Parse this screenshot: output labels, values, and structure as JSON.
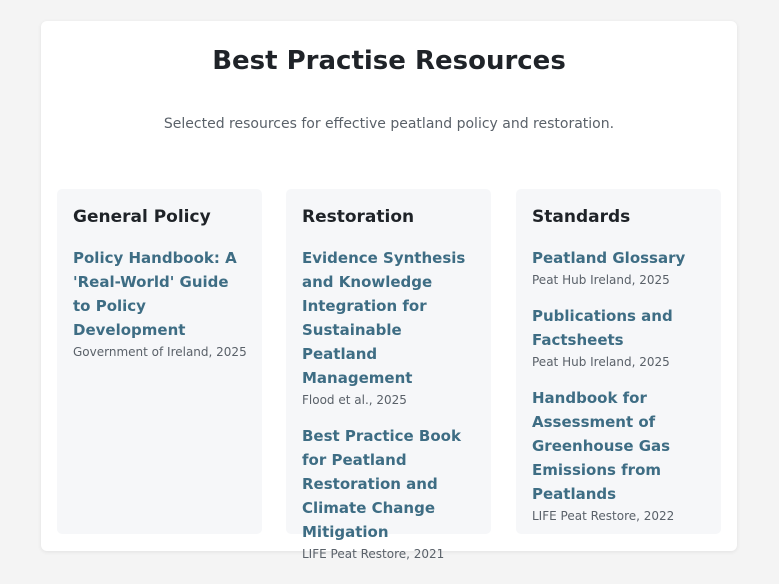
{
  "page": {
    "title": "Best Practise Resources",
    "subtitle": "Selected resources for effective peatland policy and restoration."
  },
  "columns": [
    {
      "title": "General Policy",
      "resources": [
        {
          "title": "Policy Handbook: A 'Real-World' Guide to Policy Development",
          "meta": "Government of Ireland, 2025"
        }
      ]
    },
    {
      "title": "Restoration",
      "resources": [
        {
          "title": "Evidence Synthesis and Knowledge Integration for Sustainable Peatland Management",
          "meta": "Flood et al., 2025"
        },
        {
          "title": "Best Practice Book for Peatland Restoration and Climate Change Mitigation",
          "meta": "LIFE Peat Restore, 2021"
        }
      ]
    },
    {
      "title": "Standards",
      "resources": [
        {
          "title": "Peatland Glossary",
          "meta": "Peat Hub Ireland, 2025"
        },
        {
          "title": "Publications and Factsheets",
          "meta": "Peat Hub Ireland, 2025"
        },
        {
          "title": "Handbook for Assessment of Greenhouse Gas Emissions from Peatlands",
          "meta": "LIFE Peat Restore, 2022"
        }
      ]
    }
  ],
  "colors": {
    "link": "#3e6d84",
    "heading": "#1f2328",
    "muted": "#5a6169",
    "column_bg": "#f6f7f9",
    "page_bg": "#f4f4f4"
  }
}
